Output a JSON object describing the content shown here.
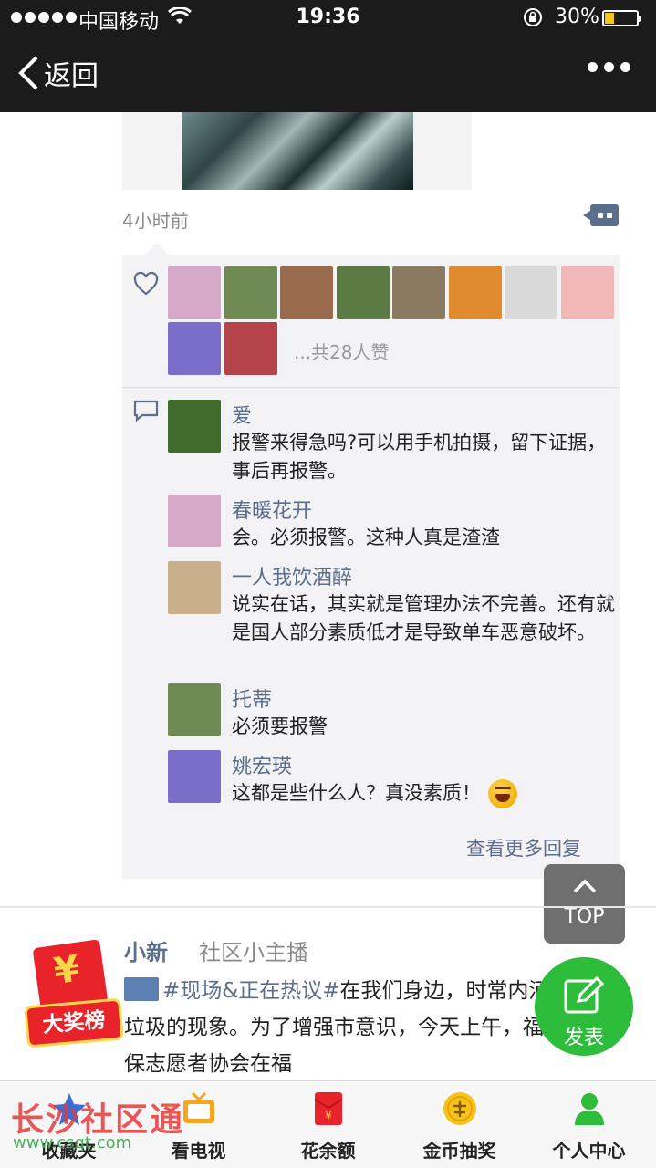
{
  "status_bar": {
    "carrier": "中国移动",
    "time": "19:36",
    "battery": "30%",
    "battery_level": 0.3
  },
  "nav": {
    "back_label": "返回"
  },
  "post": {
    "time": "4小时前",
    "likes_text": "...共28人赞",
    "like_avatar_colors": [
      "#d7a9c8",
      "#6f8a52",
      "#9a6a4c",
      "#5c7a44",
      "#8a7a60",
      "#e08a30",
      "#d9d9d9",
      "#f2b8b8",
      "#7a6ec8",
      "#b5444a"
    ],
    "comments": [
      {
        "name": "爱",
        "text": "报警来得急吗?可以用手机拍摄，留下证据，事后再报警。",
        "avatar_color": "#3f6b2c"
      },
      {
        "name": "春暖花开",
        "text": "会。必须报警。这种人真是渣渣",
        "avatar_color": "#d7a9c8"
      },
      {
        "name": "一人我饮酒醉",
        "text": "说实在话，其实就是管理办法不完善。还有就是国人部分素质低才是导致单车恶意破坏。",
        "avatar_color": "#c9b08a"
      },
      {
        "name": "托蒂",
        "text": "必须要报警",
        "avatar_color": "#6f8a52"
      },
      {
        "name": "姚宏瑛",
        "text": "这都是些什么人？真没素质！",
        "avatar_color": "#7a6ec8"
      }
    ],
    "more_replies": "查看更多回复"
  },
  "top_button": {
    "label": "TOP"
  },
  "next_post": {
    "author": "小新",
    "role": "社区小主播",
    "topic": "#现场&正在热议#",
    "text": "在我们身边，时常内河里丢弃垃圾的现象。为了增强市意识，今天上午，福建省环保志愿者协会在福"
  },
  "award_badge": {
    "label": "大奖榜"
  },
  "publish_button": {
    "label": "发表"
  },
  "tabbar": {
    "tabs": [
      {
        "label": "收藏夹",
        "icon": "star-icon"
      },
      {
        "label": "看电视",
        "icon": "tv-icon"
      },
      {
        "label": "花余额",
        "icon": "red-envelope-icon"
      },
      {
        "label": "金币抽奖",
        "icon": "coin-icon"
      },
      {
        "label": "个人中心",
        "icon": "person-icon"
      }
    ]
  },
  "watermark": {
    "text": "长沙社区通",
    "url": "www.csqt.com"
  },
  "colors": {
    "link": "#5b6e8c",
    "green": "#2dbd3a",
    "nav_bg": "#1b1b1b"
  }
}
